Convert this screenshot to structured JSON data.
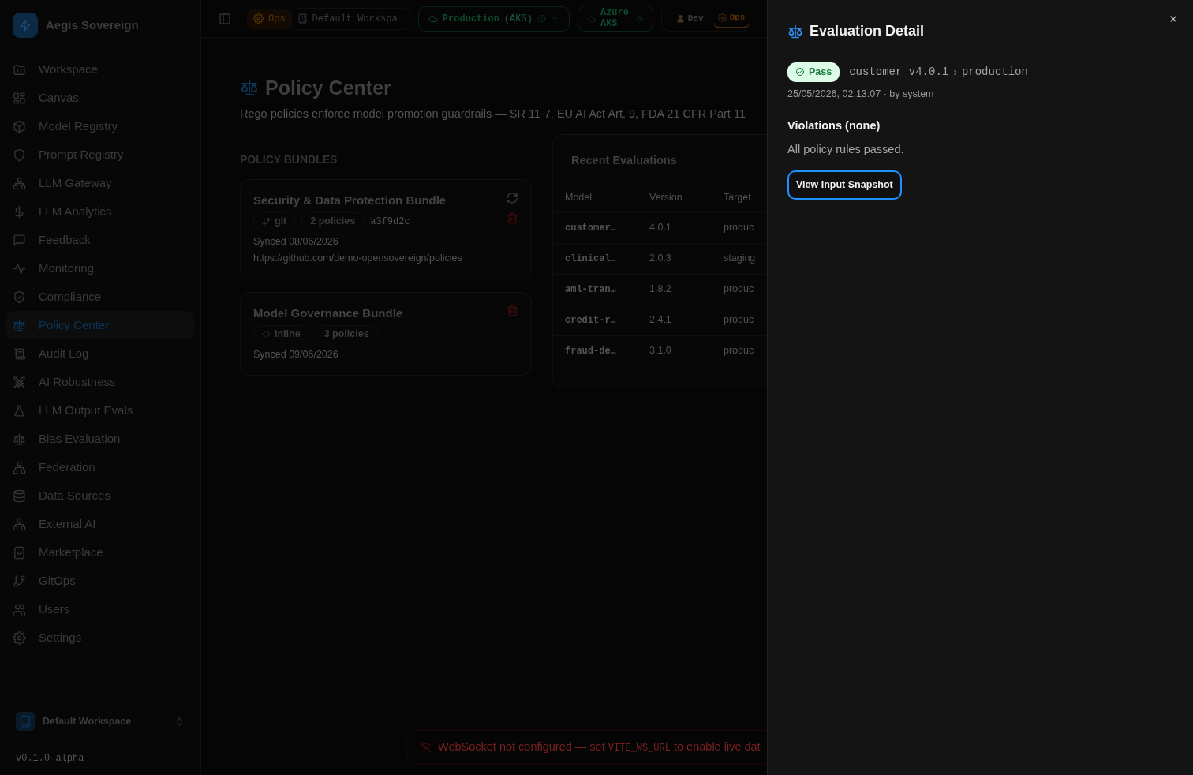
{
  "brand": "Aegis Sovereign",
  "sidebar": {
    "items": [
      {
        "label": "Workspace",
        "selected": false
      },
      {
        "label": "Canvas",
        "selected": false
      },
      {
        "label": "Model Registry",
        "selected": false
      },
      {
        "label": "Prompt Registry",
        "selected": false
      },
      {
        "label": "LLM Gateway",
        "selected": false
      },
      {
        "label": "LLM Analytics",
        "selected": false
      },
      {
        "label": "Feedback",
        "selected": false
      },
      {
        "label": "Monitoring",
        "selected": false
      },
      {
        "label": "Compliance",
        "selected": false
      },
      {
        "label": "Policy Center",
        "selected": true
      },
      {
        "label": "Audit Log",
        "selected": false
      },
      {
        "label": "AI Robustness",
        "selected": false
      },
      {
        "label": "LLM Output Evals",
        "selected": false
      },
      {
        "label": "Bias Evaluation",
        "selected": false
      },
      {
        "label": "Federation",
        "selected": false
      },
      {
        "label": "Data Sources",
        "selected": false
      },
      {
        "label": "External AI",
        "selected": false
      },
      {
        "label": "Marketplace",
        "selected": false
      },
      {
        "label": "GitOps",
        "selected": false
      },
      {
        "label": "Users",
        "selected": false
      },
      {
        "label": "Settings",
        "selected": false
      }
    ],
    "workspace": "Default Workspace",
    "version": "v0.1.0-alpha"
  },
  "topbar": {
    "role_badge": "Ops",
    "workspace": "Default Workspa…",
    "environment": "Production",
    "environment_note": "(AKS)",
    "cluster": "Azure AKS",
    "roles": [
      {
        "label": "Dev",
        "selected": false
      },
      {
        "label": "Ops",
        "selected": true
      }
    ]
  },
  "page": {
    "title": "Policy Center",
    "subtitle": "Rego policies enforce model promotion guardrails — SR 11-7, EU AI Act Art. 9, FDA 21 CFR Part 11",
    "bundles_heading": "POLICY BUNDLES",
    "bundles": [
      {
        "title": "Security & Data Protection Bundle",
        "source": "git",
        "kind": "git",
        "policies": "2 policies",
        "commit": "a3f9d2c",
        "synced": "Synced 08/06/2026",
        "url": "https://github.com/demo-opensovereign/policies",
        "syncable": true
      },
      {
        "title": "Model Governance Bundle",
        "source": "inline",
        "kind": "inline",
        "policies": "3 policies",
        "synced": "Synced 09/06/2026",
        "syncable": false
      }
    ],
    "evaluations": {
      "title": "Recent Evaluations",
      "columns": [
        "Model",
        "Version",
        "Target"
      ],
      "rows": [
        [
          "customer…",
          "4.0.1",
          "produc"
        ],
        [
          "clinical…",
          "2.0.3",
          "staging"
        ],
        [
          "aml-tran…",
          "1.8.2",
          "produc"
        ],
        [
          "credit-r…",
          "2.4.1",
          "produc"
        ],
        [
          "fraud-de…",
          "3.1.0",
          "produc"
        ]
      ]
    }
  },
  "toast": {
    "before": "WebSocket not configured — set ",
    "code": "VITE_WS_URL",
    "after": " to enable live dat"
  },
  "drawer": {
    "title": "Evaluation Detail",
    "status": {
      "label": "Pass",
      "kind": "pass"
    },
    "subject": "customer v4.0.1",
    "separator": "›",
    "target": "production",
    "meta": "25/05/2026, 02:13:07 · by system",
    "violations_heading": "Violations (none)",
    "violations_note": "All policy rules passed.",
    "button": "View Input Snapshot"
  }
}
